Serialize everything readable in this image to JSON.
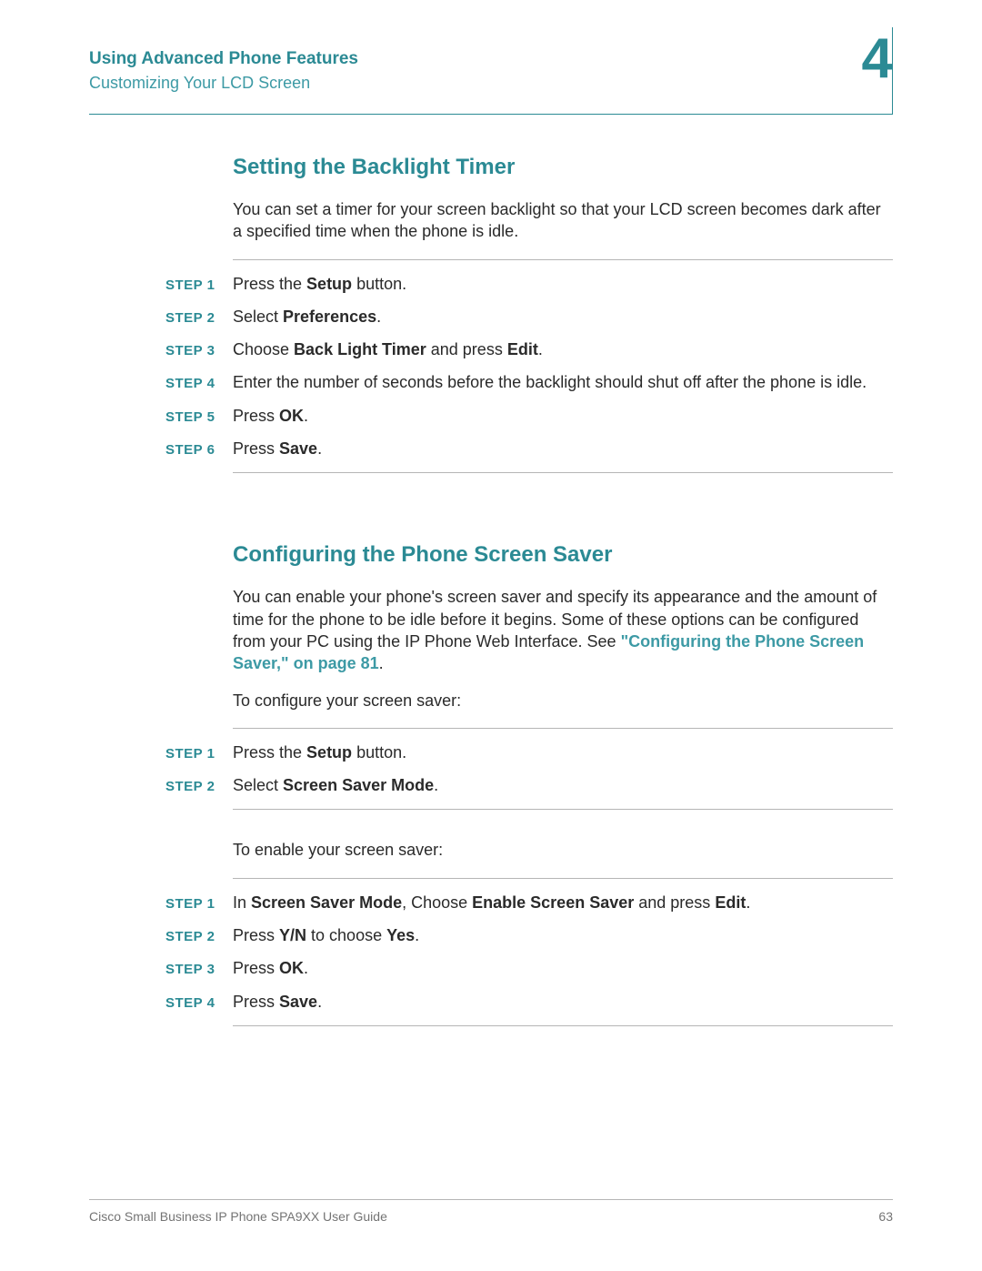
{
  "header": {
    "title": "Using Advanced Phone Features",
    "subtitle": "Customizing Your LCD Screen",
    "chapter_number": "4"
  },
  "sections": [
    {
      "heading": "Setting the Backlight Timer",
      "intro_parts": [
        {
          "text": "You can set a timer for your screen backlight so that your LCD screen becomes dark after a specified time when the phone is idle."
        }
      ],
      "step_groups": [
        {
          "steps": [
            {
              "label": "STEP 1",
              "parts": [
                {
                  "text": "Press the "
                },
                {
                  "text": "Setup",
                  "bold": true
                },
                {
                  "text": " button."
                }
              ]
            },
            {
              "label": "STEP 2",
              "parts": [
                {
                  "text": "Select "
                },
                {
                  "text": "Preferences",
                  "bold": true
                },
                {
                  "text": "."
                }
              ]
            },
            {
              "label": "STEP 3",
              "parts": [
                {
                  "text": "Choose "
                },
                {
                  "text": "Back Light Timer",
                  "bold": true
                },
                {
                  "text": " and press "
                },
                {
                  "text": "Edit",
                  "bold": true
                },
                {
                  "text": "."
                }
              ]
            },
            {
              "label": "STEP 4",
              "parts": [
                {
                  "text": "Enter the number of seconds before the backlight should shut off after the phone is idle."
                }
              ]
            },
            {
              "label": "STEP 5",
              "parts": [
                {
                  "text": "Press "
                },
                {
                  "text": "OK",
                  "bold": true
                },
                {
                  "text": "."
                }
              ]
            },
            {
              "label": "STEP 6",
              "parts": [
                {
                  "text": "Press "
                },
                {
                  "text": "Save",
                  "bold": true
                },
                {
                  "text": "."
                }
              ]
            }
          ]
        }
      ]
    },
    {
      "heading": "Configuring the Phone Screen Saver",
      "intro_parts": [
        {
          "text": "You can enable your phone's screen saver and specify its appearance and the amount of time for the phone to be idle before it begins. Some of these options can be configured from your PC using the IP Phone Web Interface. See "
        },
        {
          "text": "\"Configuring the Phone Screen Saver,\" on page 81",
          "link": true
        },
        {
          "text": "."
        }
      ],
      "pre_texts": [
        "To configure your screen saver:"
      ],
      "step_groups": [
        {
          "steps": [
            {
              "label": "STEP 1",
              "parts": [
                {
                  "text": "Press the "
                },
                {
                  "text": "Setup",
                  "bold": true
                },
                {
                  "text": " button."
                }
              ]
            },
            {
              "label": "STEP 2",
              "parts": [
                {
                  "text": "Select "
                },
                {
                  "text": "Screen Saver Mode",
                  "bold": true
                },
                {
                  "text": "."
                }
              ]
            }
          ]
        },
        {
          "pre_text": "To enable your screen saver:",
          "steps": [
            {
              "label": "STEP 1",
              "parts": [
                {
                  "text": "In "
                },
                {
                  "text": "Screen Saver Mode",
                  "bold": true
                },
                {
                  "text": ", Choose "
                },
                {
                  "text": "Enable Screen Saver",
                  "bold": true
                },
                {
                  "text": " and press "
                },
                {
                  "text": "Edit",
                  "bold": true
                },
                {
                  "text": "."
                }
              ]
            },
            {
              "label": "STEP 2",
              "parts": [
                {
                  "text": "Press "
                },
                {
                  "text": "Y/N",
                  "bold": true
                },
                {
                  "text": " to choose "
                },
                {
                  "text": "Yes",
                  "bold": true
                },
                {
                  "text": "."
                }
              ]
            },
            {
              "label": "STEP 3",
              "parts": [
                {
                  "text": "Press "
                },
                {
                  "text": "OK",
                  "bold": true
                },
                {
                  "text": "."
                }
              ]
            },
            {
              "label": "STEP 4",
              "parts": [
                {
                  "text": "Press "
                },
                {
                  "text": "Save",
                  "bold": true
                },
                {
                  "text": "."
                }
              ]
            }
          ]
        }
      ]
    }
  ],
  "footer": {
    "doc_title": "Cisco Small Business IP Phone SPA9XX User Guide",
    "page_number": "63"
  }
}
